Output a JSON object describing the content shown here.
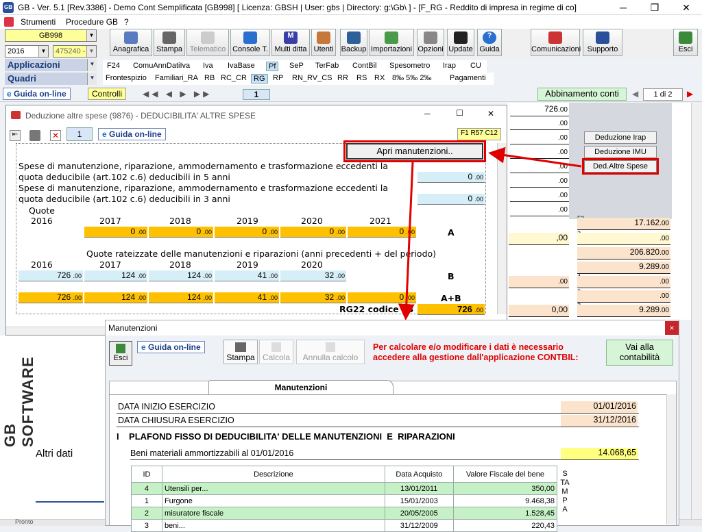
{
  "titlebar": {
    "text": "GB - Ver. 5.1 [Rev.3386] -  Demo Cont Semplificata [GB998]     [ Licenza: GBSH | User: gbs | Directory: g:\\Gb\\ ] - [F_RG - Reddito di impresa in regime di co]"
  },
  "menu": {
    "items": [
      "Strumenti",
      "Procedure GB",
      "?"
    ]
  },
  "selectors": {
    "company": "GB998",
    "year": "2016",
    "code": "475240 -"
  },
  "side": {
    "applicazioni": "Applicazioni",
    "quadri": "Quadri"
  },
  "toolbar": {
    "buttons": [
      "Anagrafica",
      "Stampa",
      "Telematico",
      "Console T.",
      "Multi ditta",
      "Utenti",
      "Backup",
      "Importazioni",
      "Opzioni",
      "Update",
      "Guida",
      "Comunicazioni",
      "Supporto",
      "Esci"
    ]
  },
  "tabs1": [
    "F24",
    "ComuAnnDatiIva",
    "Iva",
    "IvaBase",
    "Pf",
    "SeP",
    "TerFab",
    "ContBil",
    "Spesometro",
    "Irap",
    "CU"
  ],
  "tabs2": [
    "Frontespizio",
    "Familiari_RA",
    "RB",
    "RC_CR",
    "RG",
    "RP",
    "RN_RV_CS",
    "RR",
    "RS",
    "RX",
    "8‰ 5‰ 2‰",
    "Pagamenti"
  ],
  "nav": {
    "guide": "Guida on-line",
    "controlli": "Controlli",
    "page": "1",
    "abbinamento": "Abbinamento conti",
    "pageinfo": "1 di 2"
  },
  "right": {
    "vals": [
      "726",
      "",
      "",
      "",
      "",
      "",
      "",
      "",
      ""
    ],
    "dec": ".00",
    "btns": [
      "Deduzione Irap",
      "Deduzione IMU",
      "Ded.Altre Spese"
    ],
    "big": [
      "17.162",
      "",
      "206.820",
      "9.289",
      "",
      "",
      "9.289"
    ],
    "sup": [
      "53",
      "3",
      "4",
      "3",
      "2"
    ],
    "bottom_left": "0,00",
    "left_zero": ",00"
  },
  "dlg1": {
    "title": "Deduzione altre spese (9876) - DEDUCIBILITA' ALTRE SPESE",
    "page": "1",
    "guide": "Guida on-line",
    "code": "F1 R57 C12",
    "apri": "Apri manutenzioni..",
    "spese5_1": "Spese di manutenzione, riparazione, ammodernamento e trasformazione eccedenti la",
    "spese5_2": "quota deducibile (art.102 c.6) deducibili in 5 anni",
    "spese3_1": "Spese di manutenzione, riparazione, ammodernamento e trasformazione eccedenti la",
    "spese3_2": "quota deducibile (art.102 c.6) deducibili in 3 anni",
    "val5": "0",
    "val3": "0",
    "dec": ".00",
    "quote": "Quote",
    "years": [
      "2016",
      "2017",
      "2018",
      "2019",
      "2020",
      "2021"
    ],
    "quoteA": [
      "0",
      "0",
      "0",
      "0",
      "0"
    ],
    "labelA": "A",
    "quoteRat": "Quote rateizzate delle manutenzioni e riparazioni (anni precedenti + del periodo)",
    "years2": [
      "2016",
      "2017",
      "2018",
      "2019",
      "2020"
    ],
    "valsB": [
      "726",
      "124",
      "124",
      "41",
      "32"
    ],
    "labelB": "B",
    "valsAB": [
      "726",
      "124",
      "124",
      "41",
      "32",
      "0"
    ],
    "labelAB": "A+B",
    "rg22": "RG22 codice 13",
    "rg22val": "726"
  },
  "dlg2": {
    "title": "Manutenzioni",
    "esci": "Esci",
    "guide": "Guida on-line",
    "stampa": "Stampa",
    "calcola": "Calcola",
    "annulla": "Annulla calcolo",
    "warn1": "Per calcolare e/o modificare i dati è necessario",
    "warn2": "accedere alla gestione dall'applicazione CONTBIL:",
    "vai1": "Vai alla",
    "vai2": "contabilità",
    "tab": "Manutenzioni",
    "inizio_lbl": "DATA INIZIO ESERCIZIO",
    "inizio": "01/01/2016",
    "chiusura_lbl": "DATA CHIUSURA ESERCIZIO",
    "chiusura": "31/12/2016",
    "section": "I    PLAFOND FISSO DI DEDUCIBILITA' DELLE MANUTENZIONI  E  RIPARAZIONI",
    "beni_lbl": "Beni materiali ammortizzabili al 01/01/2016",
    "beni": "14.068,65",
    "cols": [
      "ID",
      "Descrizione",
      "Data Acquisto",
      "Valore Fiscale del bene"
    ],
    "stampa_col": "S\nTA\nM\nP\nA",
    "rows": [
      {
        "id": "4",
        "desc": "Utensili per...",
        "data": "13/01/2011",
        "val": "350,00"
      },
      {
        "id": "1",
        "desc": "Furgone",
        "data": "15/01/2003",
        "val": "9.468,38"
      },
      {
        "id": "2",
        "desc": "misuratore fiscale",
        "data": "20/05/2005",
        "val": "1.528,45"
      },
      {
        "id": "3",
        "desc": "beni...",
        "data": "31/12/2009",
        "val": "220,43"
      }
    ]
  },
  "background": {
    "logo": "GB SOFTWARE",
    "altri": "Altri dati",
    "pronto": "Pronto"
  }
}
